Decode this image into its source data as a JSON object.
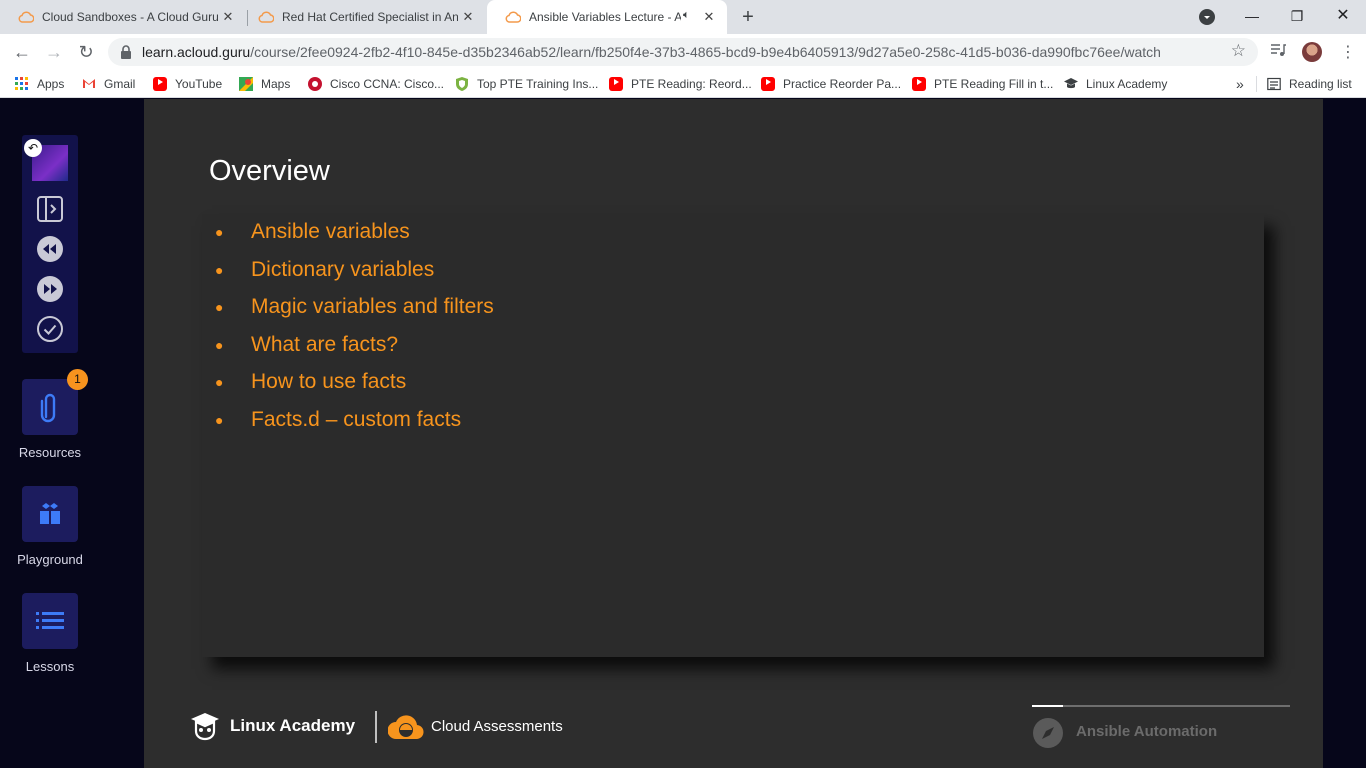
{
  "browser": {
    "tabs": [
      {
        "title": "Cloud Sandboxes - A Cloud Guru",
        "active": false
      },
      {
        "title": "Red Hat Certified Specialist in An",
        "active": false
      },
      {
        "title": "Ansible Variables Lecture - A",
        "active": true
      }
    ],
    "url_domain": "learn.acloud.guru",
    "url_path": "/course/2fee0924-2fb2-4f10-845e-d35b2346ab52/learn/fb250f4e-37b3-4865-bcd9-b9e4b6405913/9d27a5e0-258c-41d5-b036-da990fbc76ee/watch",
    "bookmarks": [
      {
        "label": "Apps",
        "icon": "apps-grid-icon"
      },
      {
        "label": "Gmail",
        "icon": "gmail-icon"
      },
      {
        "label": "YouTube",
        "icon": "youtube-icon"
      },
      {
        "label": "Maps",
        "icon": "maps-icon"
      },
      {
        "label": "Cisco CCNA: Cisco...",
        "icon": "cisco-icon"
      },
      {
        "label": "Top PTE Training Ins...",
        "icon": "shield-badge-icon"
      },
      {
        "label": "PTE Reading: Reord...",
        "icon": "youtube-icon"
      },
      {
        "label": "Practice Reorder Pa...",
        "icon": "youtube-icon"
      },
      {
        "label": "PTE Reading Fill in t...",
        "icon": "youtube-icon"
      },
      {
        "label": "Linux Academy",
        "icon": "graduation-cap-icon"
      }
    ],
    "bookmarks_overflow": "»",
    "reading_list": "Reading list"
  },
  "sidebar": {
    "resources": {
      "label": "Resources",
      "badge": "1"
    },
    "playground": {
      "label": "Playground"
    },
    "lessons": {
      "label": "Lessons"
    }
  },
  "slide": {
    "title": "Overview",
    "bullets": [
      "Ansible variables",
      "Dictionary variables",
      "Magic variables and filters",
      "What are facts?",
      "How to use facts",
      "Facts.d – custom facts"
    ],
    "footer": {
      "brand_left": "Linux Academy",
      "brand_right": "Cloud Assessments",
      "course": "Ansible Automation",
      "progress_fraction": 0.12
    }
  },
  "colors": {
    "accent_orange": "#f7941d",
    "slide_bg": "#2d2d2d",
    "sidebar_bg": "#06061a",
    "sidebar_button": "#1c1c5e",
    "icon_blue": "#3d7bf7"
  }
}
